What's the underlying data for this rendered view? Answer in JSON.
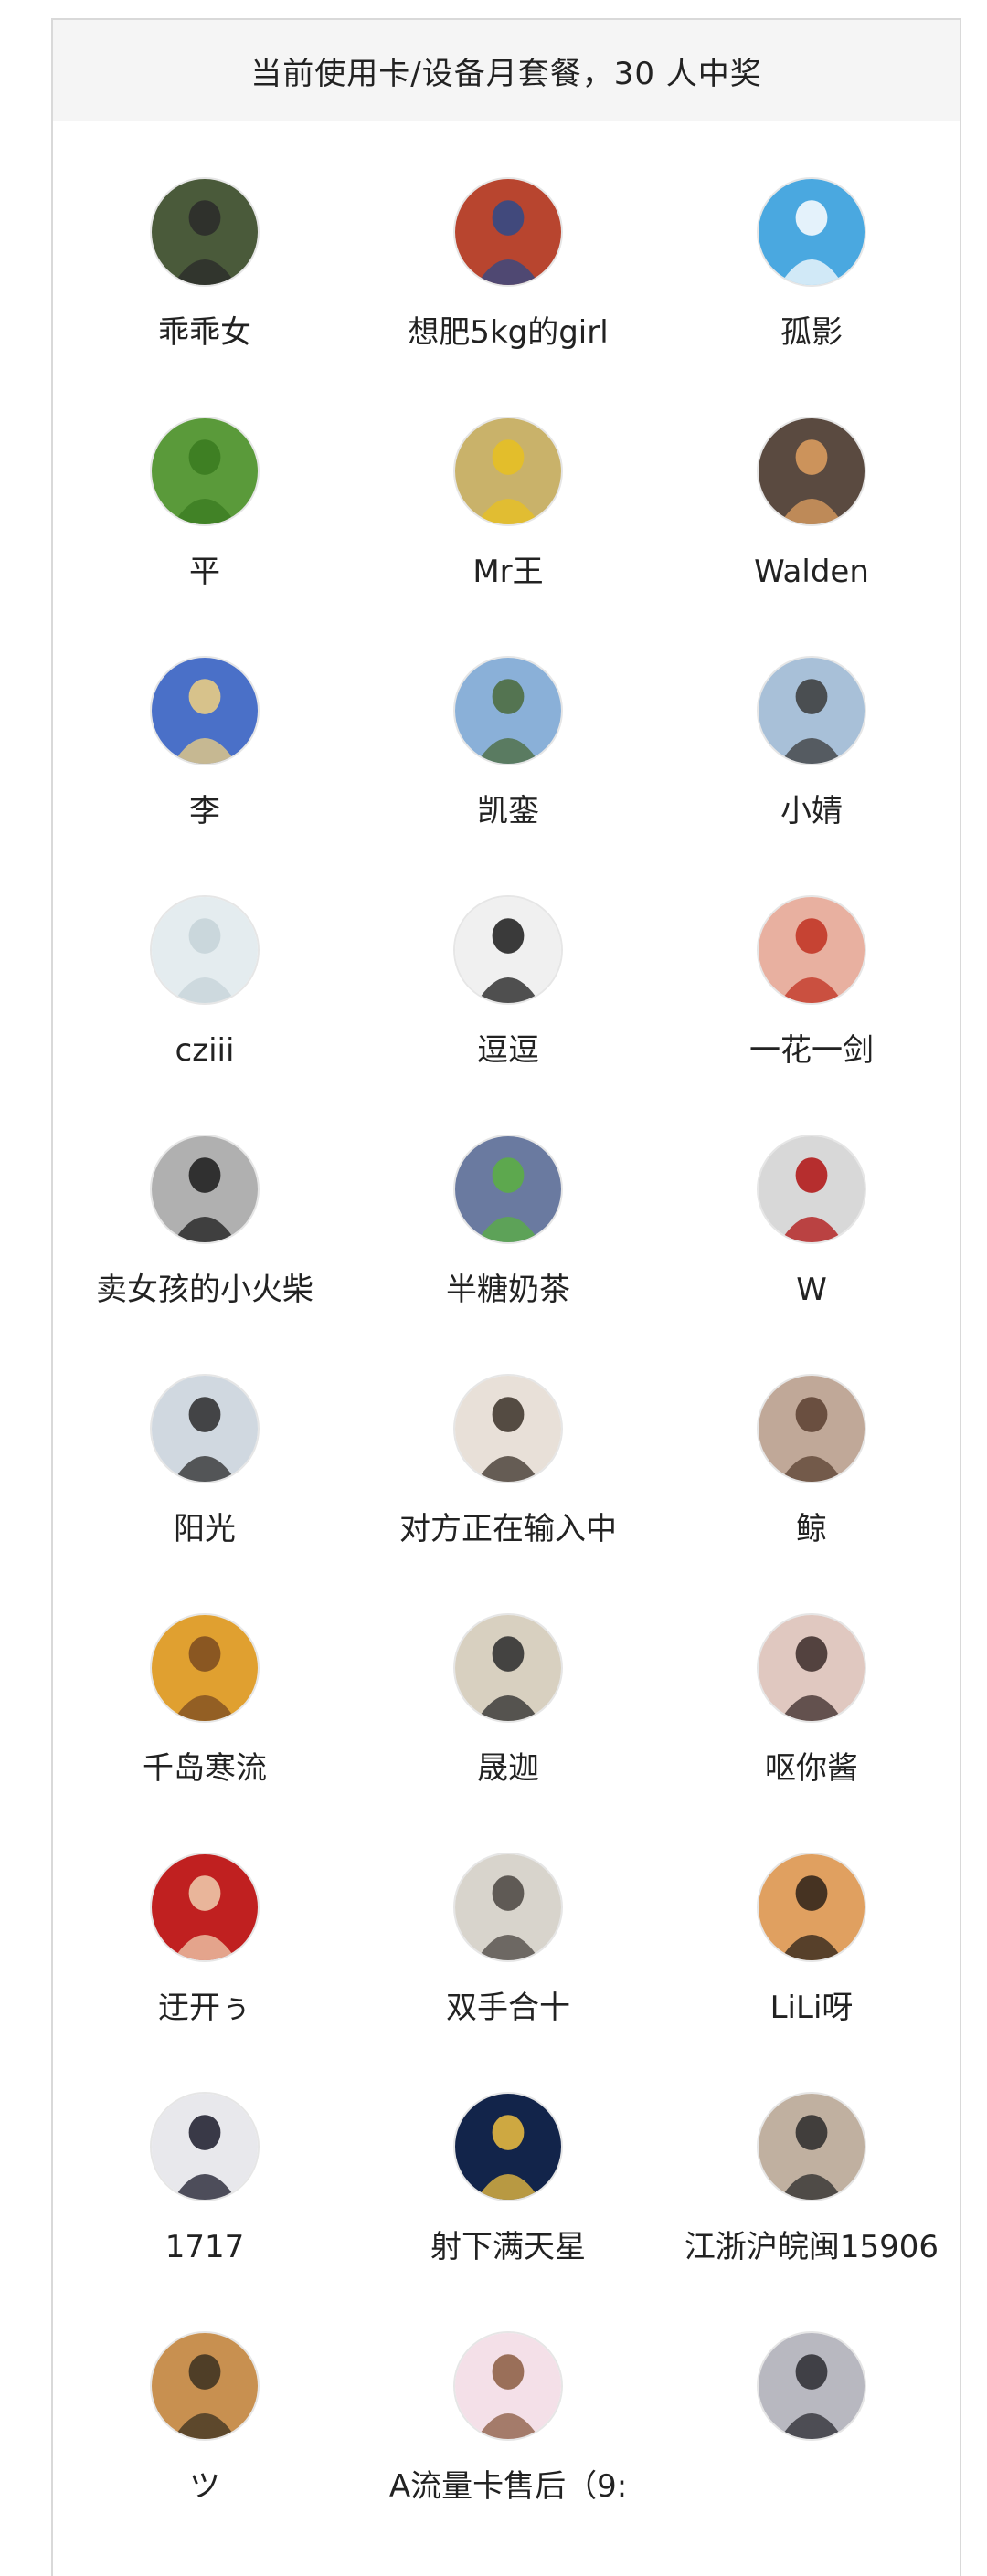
{
  "header": {
    "title": "当前使用卡/设备月套餐，30 人中奖"
  },
  "winners": [
    {
      "name": "乖乖女",
      "avatar": "forest-person-icon",
      "bg": "#4a5a3a",
      "fg": "#2a2a2a"
    },
    {
      "name": "想肥5kg的girl",
      "avatar": "red-trees-person-icon",
      "bg": "#b8452f",
      "fg": "#2c4a8a"
    },
    {
      "name": "孤影",
      "avatar": "cartoon-dog-icon",
      "bg": "#4aa8e0",
      "fg": "#ffffff"
    },
    {
      "name": "平",
      "avatar": "green-apples-icon",
      "bg": "#5a9a3a",
      "fg": "#3a7a20"
    },
    {
      "name": "Mr王",
      "avatar": "toy-car-kid-icon",
      "bg": "#c9b26a",
      "fg": "#e8c020"
    },
    {
      "name": "Walden",
      "avatar": "shiba-dog-icon",
      "bg": "#5a4a40",
      "fg": "#e0a060"
    },
    {
      "name": "李",
      "avatar": "blue-sky-moon-icon",
      "bg": "#4a70c8",
      "fg": "#f0d080"
    },
    {
      "name": "凯銮",
      "avatar": "people-at-lookout-icon",
      "bg": "#8ab0d8",
      "fg": "#4a6a3a"
    },
    {
      "name": "小婧",
      "avatar": "person-with-view-icon",
      "bg": "#a8c0d8",
      "fg": "#3a3a3a"
    },
    {
      "name": "cziii",
      "avatar": "placeholder-mountain-icon",
      "bg": "#e4ecef",
      "fg": "#c5d3d8"
    },
    {
      "name": "逗逗",
      "avatar": "panda-icon",
      "bg": "#f0f0f0",
      "fg": "#1a1a1a"
    },
    {
      "name": "一花一剑",
      "avatar": "illustrated-girl-icon",
      "bg": "#e8b0a0",
      "fg": "#c03020"
    },
    {
      "name": "卖女孩的小火柴",
      "avatar": "cat-sunglasses-icon",
      "bg": "#b0b0b0",
      "fg": "#1a1a1a"
    },
    {
      "name": "半糖奶茶",
      "avatar": "kid-green-jacket-icon",
      "bg": "#6a7aa0",
      "fg": "#5ab040"
    },
    {
      "name": "W",
      "avatar": "china-jiayou-icon",
      "bg": "#d8d8d8",
      "fg": "#b01010"
    },
    {
      "name": "阳光",
      "avatar": "young-man-icon",
      "bg": "#d0d8e0",
      "fg": "#2a2a2a"
    },
    {
      "name": "对方正在输入中",
      "avatar": "person-glasses-icon",
      "bg": "#e8e0d8",
      "fg": "#3a3028"
    },
    {
      "name": "鲸",
      "avatar": "girl-with-flowers-icon",
      "bg": "#c0a898",
      "fg": "#5a4030"
    },
    {
      "name": "千岛寒流",
      "avatar": "two-dogs-icon",
      "bg": "#e0a030",
      "fg": "#7a4a20"
    },
    {
      "name": "晟迦",
      "avatar": "boy-glasses-icon",
      "bg": "#d8d0c0",
      "fg": "#2a2a2a"
    },
    {
      "name": "呕你酱",
      "avatar": "girl-portrait-icon",
      "bg": "#e0c8c0",
      "fg": "#3a2a28"
    },
    {
      "name": "迂开ぅ",
      "avatar": "lion-dance-girl-icon",
      "bg": "#c02020",
      "fg": "#f0d0b0"
    },
    {
      "name": "双手合十",
      "avatar": "calligraphy-yang-icon",
      "bg": "#d8d4cc",
      "fg": "#4a4440"
    },
    {
      "name": "LiLi呀",
      "avatar": "sunset-silhouette-icon",
      "bg": "#e0a060",
      "fg": "#2a2018"
    },
    {
      "name": "1717",
      "avatar": "anime-boy-icon",
      "bg": "#e8e8ec",
      "fg": "#1a1a2a"
    },
    {
      "name": "射下满天星",
      "avatar": "data-plan-ad-icon",
      "bg": "#12244a",
      "fg": "#f0c040"
    },
    {
      "name": "江浙沪皖闽15906",
      "avatar": "man-eating-icon",
      "bg": "#c0b0a0",
      "fg": "#2a2a2a"
    },
    {
      "name": "ツ",
      "avatar": "field-sunset-icon",
      "bg": "#c89050",
      "fg": "#3a3020"
    },
    {
      "name": "A流量卡售后（9:",
      "avatar": "cartoon-girl-drink-icon",
      "bg": "#f4e0e8",
      "fg": "#8a5a40"
    },
    {
      "name": "",
      "avatar": "anime-man-icon",
      "bg": "#b8b8c0",
      "fg": "#2a2a30"
    }
  ]
}
